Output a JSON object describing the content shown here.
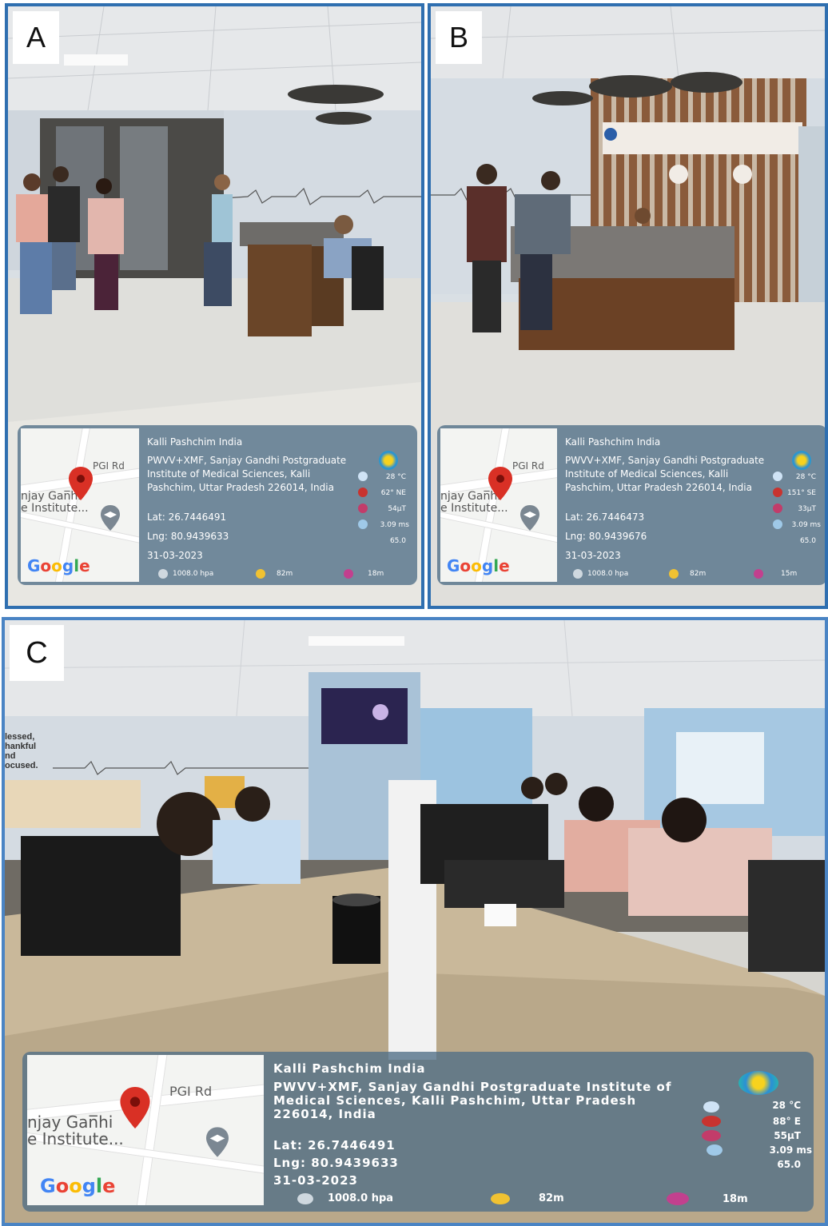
{
  "panels": {
    "a": {
      "letter": "A",
      "geotag": {
        "map": {
          "road_label": "PGI Rd",
          "place_line1": "njay Gan̅hi",
          "place_line2": "e Institute...",
          "google": "Google"
        },
        "location_title": "Kalli Pashchim India",
        "address": "PWVV+XMF, Sanjay Gandhi Postgraduate Institute of Medical Sciences, Kalli Pashchim, Uttar Pradesh 226014, India",
        "lat": "Lat: 26.7446491",
        "lng": "Lng: 80.9439633",
        "date": "31-03-2023",
        "temperature": "28 °C",
        "wind_direction": "62° NE",
        "magnetic_field": "54µT",
        "wind_speed": "3.09 ms",
        "humidity": "65.0",
        "pressure": "1008.0 hpa",
        "altitude": "82m",
        "accuracy": "18m"
      }
    },
    "b": {
      "letter": "B",
      "geotag": {
        "map": {
          "road_label": "PGI Rd",
          "place_line1": "njay Gan̅hi",
          "place_line2": "e Institute...",
          "google": "Google"
        },
        "location_title": "Kalli Pashchim India",
        "address": "PWVV+XMF, Sanjay Gandhi Postgraduate Institute of Medical Sciences, Kalli Pashchim, Uttar Pradesh 226014, India",
        "lat": "Lat: 26.7446473",
        "lng": "Lng: 80.9439676",
        "date": "31-03-2023",
        "temperature": "28 °C",
        "wind_direction": "151° SE",
        "magnetic_field": "33µT",
        "wind_speed": "3.09 ms",
        "humidity": "65.0",
        "pressure": "1008.0 hpa",
        "altitude": "82m",
        "accuracy": "15m"
      }
    },
    "c": {
      "letter": "C",
      "wall_text": [
        "lessed,",
        "hankful",
        "nd",
        "ocused."
      ],
      "geotag": {
        "map": {
          "road_label": "PGI Rd",
          "place_line1": "njay Gan̅hi",
          "place_line2": "e Institute...",
          "google": "Google"
        },
        "location_title": "Kalli Pashchim India",
        "address": "PWVV+XMF, Sanjay Gandhi Postgraduate Institute of Medical Sciences, Kalli Pashchim, Uttar Pradesh 226014, India",
        "lat": "Lat: 26.7446491",
        "lng": "Lng: 80.9439633",
        "date": "31-03-2023",
        "temperature": "28 °C",
        "wind_direction": "88° E",
        "magnetic_field": "55µT",
        "wind_speed": "3.09 ms",
        "humidity": "65.0",
        "pressure": "1008.0 hpa",
        "altitude": "82m",
        "accuracy": "18m"
      }
    }
  },
  "colors": {
    "panel_border": "#2f6fb0",
    "overlay": "#506e87",
    "pin": "#d93025"
  },
  "icons": [
    "weather-icon",
    "compass-icon",
    "magnet-icon",
    "wind-icon",
    "humidity-icon",
    "pressure-icon",
    "altitude-icon",
    "accuracy-icon",
    "map-pin-icon",
    "graduation-cap-icon"
  ]
}
